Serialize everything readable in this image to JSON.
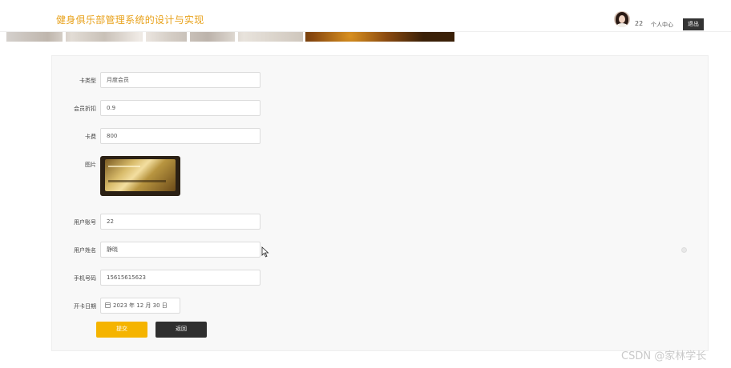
{
  "header": {
    "site_title": "健身俱乐部管理系统的设计与实现",
    "user_id": "22",
    "profile_link": "个人中心",
    "logout_label": "退出"
  },
  "form": {
    "card_type": {
      "label": "卡类型",
      "value": "月度会员"
    },
    "discount": {
      "label": "会员折扣",
      "value": "0.9"
    },
    "card_fee": {
      "label": "卡费",
      "value": "800"
    },
    "image": {
      "label": "图片"
    },
    "account": {
      "label": "用户账号",
      "value": "22"
    },
    "name": {
      "label": "用户姓名",
      "value": "静晓"
    },
    "phone": {
      "label": "手机号码",
      "value": "15615615623"
    },
    "open_date": {
      "label": "开卡日期",
      "value": "2023 年 12 月 30 日"
    }
  },
  "buttons": {
    "submit_label": "提交",
    "return_label": "返回"
  },
  "watermark": "CSDN @家林学长",
  "colors": {
    "title": "#e8a21c",
    "submit": "#f5b400",
    "return": "#2f2f2f",
    "logout": "#333333"
  },
  "icons": {
    "date": "calendar-icon",
    "pointer": "mouse-cursor-icon"
  }
}
